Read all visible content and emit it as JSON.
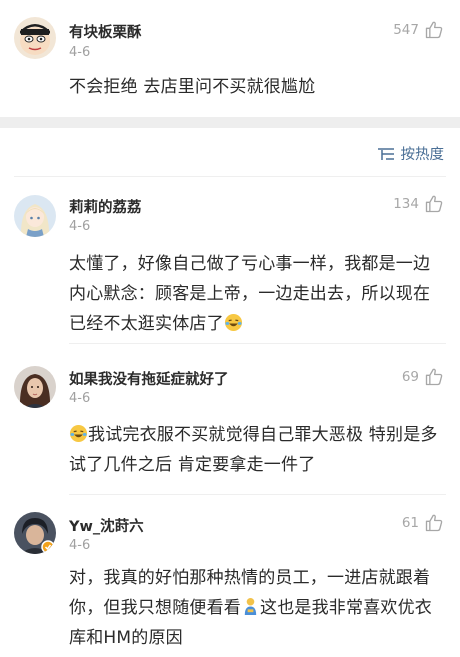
{
  "comments": [
    {
      "username": "有块板栗酥",
      "date": "4-6",
      "likes": "547",
      "text": "不会拒绝 去店里问不买就很尴尬"
    },
    {
      "username": "莉莉的荔荔",
      "date": "4-6",
      "likes": "134",
      "text": "太懂了，好像自己做了亏心事一样，我都是一边内心默念：顾客是上帝，一边走出去，所以现在已经不太逛实体店了"
    },
    {
      "username": "如果我没有拖延症就好了",
      "date": "4-6",
      "likes": "69",
      "text": "我试完衣服不买就觉得自己罪大恶极 特别是多试了几件之后 肯定要拿走一件了"
    },
    {
      "username": "Yw_沈莳六",
      "date": "4-6",
      "likes": "61",
      "text_a": "对，我真的好怕那种热情的员工，一进店就跟着你，但我只想随便看看",
      "text_b": "这也是我非常喜欢优衣库和HM的原因"
    }
  ],
  "sort": {
    "label": "按热度"
  },
  "icons": {
    "like": "thumbs-up-icon",
    "sort": "sort-lines-icon",
    "emoji_laugh": "laughing-tears-emoji",
    "emoji_person": "bowing-person-emoji"
  },
  "colors": {
    "link": "#4a6f96",
    "muted": "#a0a0a0",
    "band": "#eeeeee"
  }
}
